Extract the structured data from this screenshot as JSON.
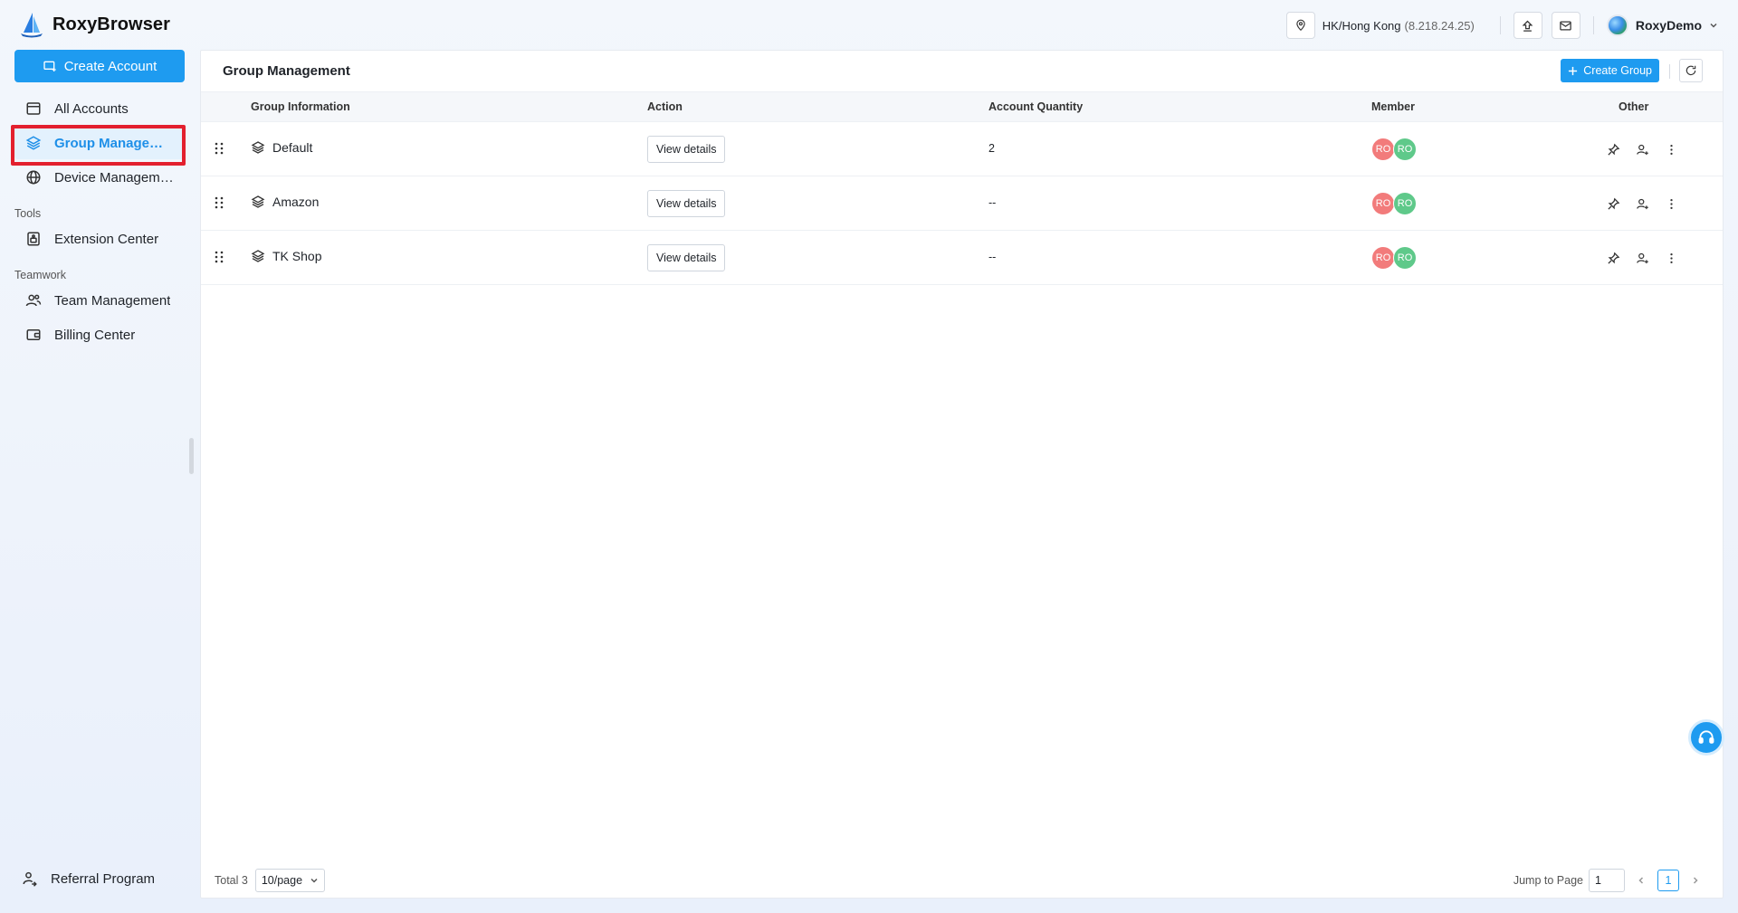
{
  "app": {
    "name": "RoxyBrowser"
  },
  "topbar": {
    "location": "HK/Hong Kong",
    "ip": "(8.218.24.25)",
    "user": "RoxyDemo"
  },
  "sidebar": {
    "create_label": "Create Account",
    "items": [
      {
        "label": "All Accounts",
        "icon": "card-icon"
      },
      {
        "label": "Group Management",
        "icon": "layers-icon",
        "active": true
      },
      {
        "label": "Device Management",
        "icon": "globe-icon"
      }
    ],
    "tools_label": "Tools",
    "tools": [
      {
        "label": "Extension Center",
        "icon": "extension-icon"
      }
    ],
    "teamwork_label": "Teamwork",
    "teamwork": [
      {
        "label": "Team Management",
        "icon": "team-icon"
      },
      {
        "label": "Billing Center",
        "icon": "wallet-icon"
      }
    ],
    "referral_label": "Referral Program"
  },
  "main": {
    "title": "Group Management",
    "create_group_label": "Create Group",
    "columns": [
      "Group Information",
      "Action",
      "Account Quantity",
      "Member",
      "Other"
    ],
    "rows": [
      {
        "name": "Default",
        "action": "View details",
        "quantity": "2",
        "members": [
          "RO",
          "RO"
        ]
      },
      {
        "name": "Amazon",
        "action": "View details",
        "quantity": "--",
        "members": [
          "RO",
          "RO"
        ]
      },
      {
        "name": "TK Shop",
        "action": "View details",
        "quantity": "--",
        "members": [
          "RO",
          "RO"
        ]
      }
    ],
    "footer": {
      "total": "Total 3",
      "page_size": "10/page",
      "jump_label": "Jump to Page",
      "jump_value": "1",
      "current_page": "1"
    }
  },
  "colors": {
    "accent": "#1e9bf0",
    "highlight": "#e3202e",
    "member_a": "#f27b7b",
    "member_b": "#5fc98a"
  }
}
